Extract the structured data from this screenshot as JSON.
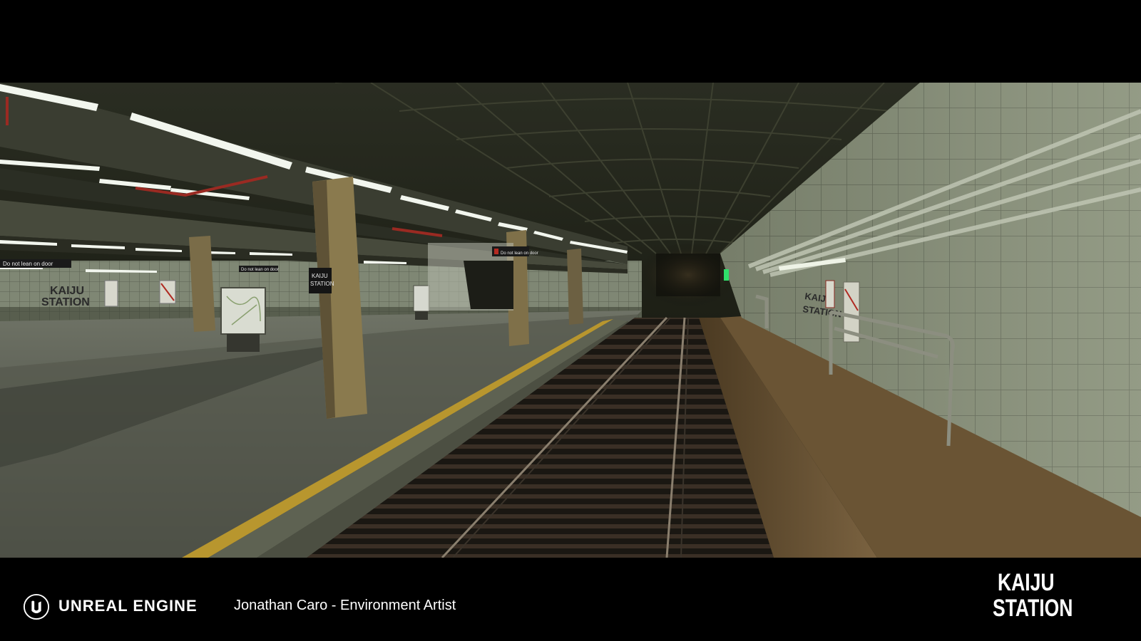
{
  "footer": {
    "brand": "UNREAL ENGINE",
    "credit": "Jonathan Caro - Environment Artist",
    "title_line1": "KAIJU",
    "title_line2": "STATION"
  },
  "scene": {
    "wall_sign_line1": "KAIJU",
    "wall_sign_line2": "STATION",
    "pillar_sign_line1": "KAIJU",
    "pillar_sign_line2": "STATION",
    "right_wall_sign_line1": "KAIJU",
    "right_wall_sign_line2": "STATION",
    "door_sign_left": "Do not lean on door",
    "door_sign_mid": "Do not lean on door",
    "door_sign_right": "Do not lean on door"
  },
  "colors": {
    "tactile_strip": "#b8962e",
    "tile_wall": "#8e9680",
    "ceiling": "#1c1e17"
  },
  "icons": [
    "unreal-engine-logo"
  ]
}
